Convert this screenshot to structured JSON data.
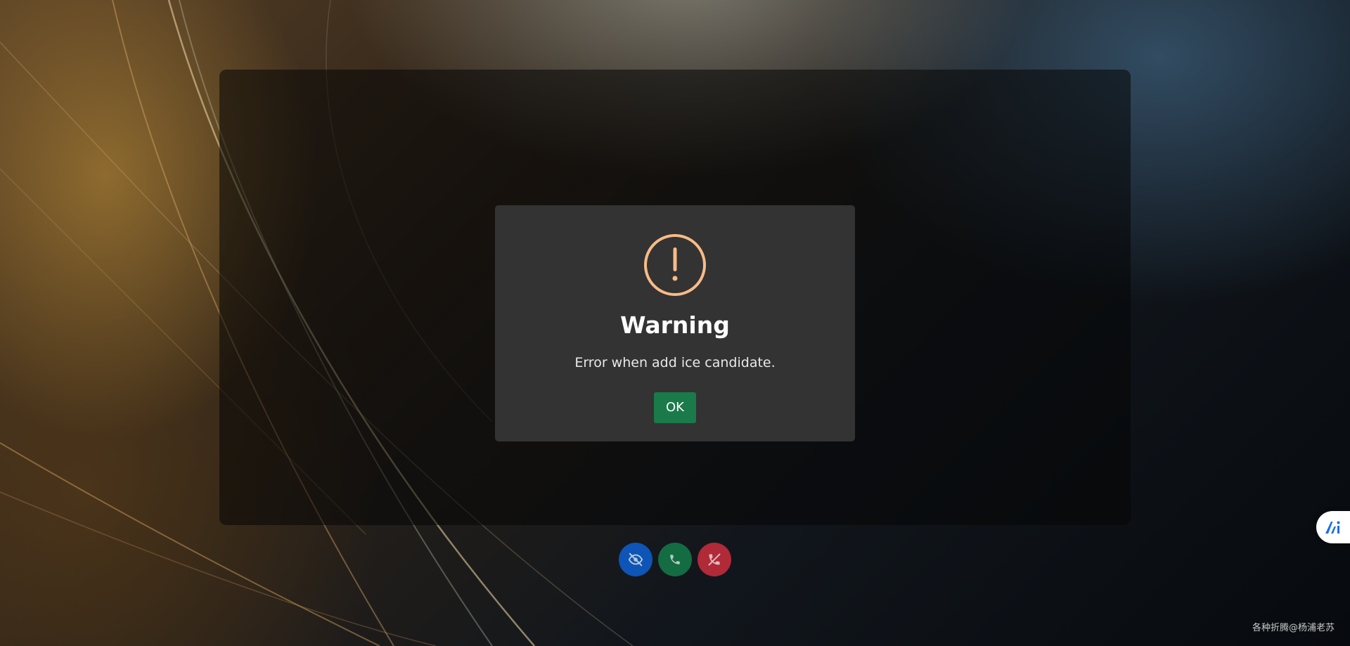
{
  "dialog": {
    "title": "Warning",
    "message": "Error when add ice candidate.",
    "ok_label": "OK",
    "icon": "exclamation-circle-icon",
    "icon_color": "#f8bb86"
  },
  "controls": [
    {
      "name": "toggle-video-button",
      "icon": "eye-slash-icon",
      "color": "#0d55b6"
    },
    {
      "name": "answer-call-button",
      "icon": "phone-icon",
      "color": "#146c43"
    },
    {
      "name": "hang-up-button",
      "icon": "phone-slash-icon",
      "color": "#b02a37"
    }
  ],
  "side_widget": {
    "icon": "ai-assistant-icon",
    "accent": "#1a6cf0"
  },
  "watermark": "各种折腾@杨浦老苏"
}
